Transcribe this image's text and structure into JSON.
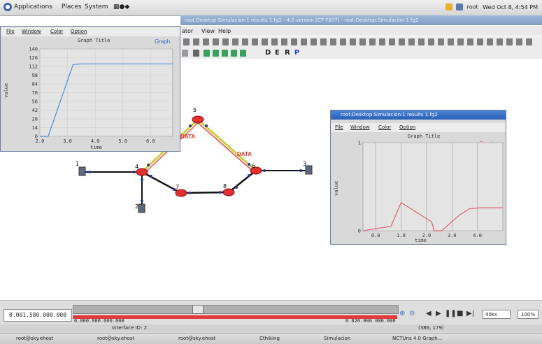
{
  "top_panel": {
    "menus": [
      "Applications",
      "Places",
      "System"
    ],
    "user": "root",
    "clock": "Wed Oct 8, 4:54 PM"
  },
  "main_window": {
    "title": "root:Desktop:Simulacion:1 results 1.fg2 - 4.0 version [CT-7207] - root:Desktop:Simulacion 1.fg2",
    "menu": [
      "ator",
      "View",
      "Help"
    ],
    "toolbar_letters": [
      "D",
      "E",
      "R",
      "P"
    ]
  },
  "graph_window_left": {
    "menu": [
      "File",
      "Window",
      "Color",
      "Option"
    ],
    "graph_title": "Graph Title",
    "legend": "Graph",
    "ylabel": "value",
    "xlabel": "time",
    "yticks": [
      "140",
      "126",
      "112",
      "98",
      "84",
      "70",
      "56",
      "42",
      "28",
      "14",
      "0"
    ],
    "xticks": [
      "2.0",
      "3.0",
      "4.0",
      "5.0",
      "6.0"
    ]
  },
  "graph_window_right": {
    "title": "root:Desktop:Simulacion:1 results 1.fg2",
    "menu": [
      "File",
      "Window",
      "Color",
      "Option"
    ],
    "graph_title": "Graph Title",
    "legend": "Graph",
    "ylabel": "value",
    "xlabel": "time",
    "yticks": [
      "1",
      "0"
    ],
    "xticks": [
      "0.0",
      "1.0",
      "2.0",
      "3.0",
      "4.0"
    ]
  },
  "network": {
    "nodes": [
      {
        "id": "1",
        "kind": "host"
      },
      {
        "id": "2",
        "kind": "host"
      },
      {
        "id": "3",
        "kind": "host"
      },
      {
        "id": "4",
        "kind": "router"
      },
      {
        "id": "5",
        "kind": "router"
      },
      {
        "id": "6",
        "kind": "router"
      },
      {
        "id": "7",
        "kind": "router"
      },
      {
        "id": "8",
        "kind": "router"
      }
    ],
    "labels": [
      "DATA",
      "DATA"
    ]
  },
  "controls": {
    "current_time": "0.001.580.000.000",
    "start_time": "0.000.000.000.000",
    "end_time": "0.020.000.000.000",
    "interface": "Interface ID: 2",
    "coords": "(386, 179)",
    "speed": "40ks",
    "zoom": "100%"
  },
  "taskbar": {
    "items": [
      "root@sky.ehost",
      "root@sky.ehost",
      "root@sky.ehost",
      "Cthiking",
      "Simulacion",
      "NCTUns 4.0 Graph..."
    ]
  },
  "colors": {
    "window_title": "#2860b8",
    "left_chart_line": "#4a90d9",
    "right_chart_line": "#e06070",
    "link_black": "#111111",
    "link_data": "#c8d040",
    "router": "#e03030",
    "timeline_red": "#e23a3a"
  },
  "chart_data": [
    {
      "type": "line",
      "title": "Graph Title",
      "xlabel": "time",
      "ylabel": "value",
      "xlim": [
        2.0,
        6.8
      ],
      "ylim": [
        0,
        140
      ],
      "series": [
        {
          "name": "Graph",
          "x": [
            2.0,
            2.3,
            3.2,
            3.5,
            6.8
          ],
          "y": [
            0,
            0,
            115,
            116,
            116
          ]
        }
      ]
    },
    {
      "type": "line",
      "title": "Graph Title",
      "xlabel": "time",
      "ylabel": "value",
      "xlim": [
        -0.5,
        5.0
      ],
      "ylim": [
        0,
        1
      ],
      "series": [
        {
          "name": "Graph",
          "x": [
            -0.5,
            0.6,
            1.0,
            2.2,
            2.3,
            2.6,
            3.3,
            3.7,
            4.1,
            5.0
          ],
          "y": [
            0.0,
            0.05,
            0.32,
            0.1,
            0.0,
            0.0,
            0.18,
            0.25,
            0.26,
            0.26
          ]
        }
      ]
    }
  ]
}
